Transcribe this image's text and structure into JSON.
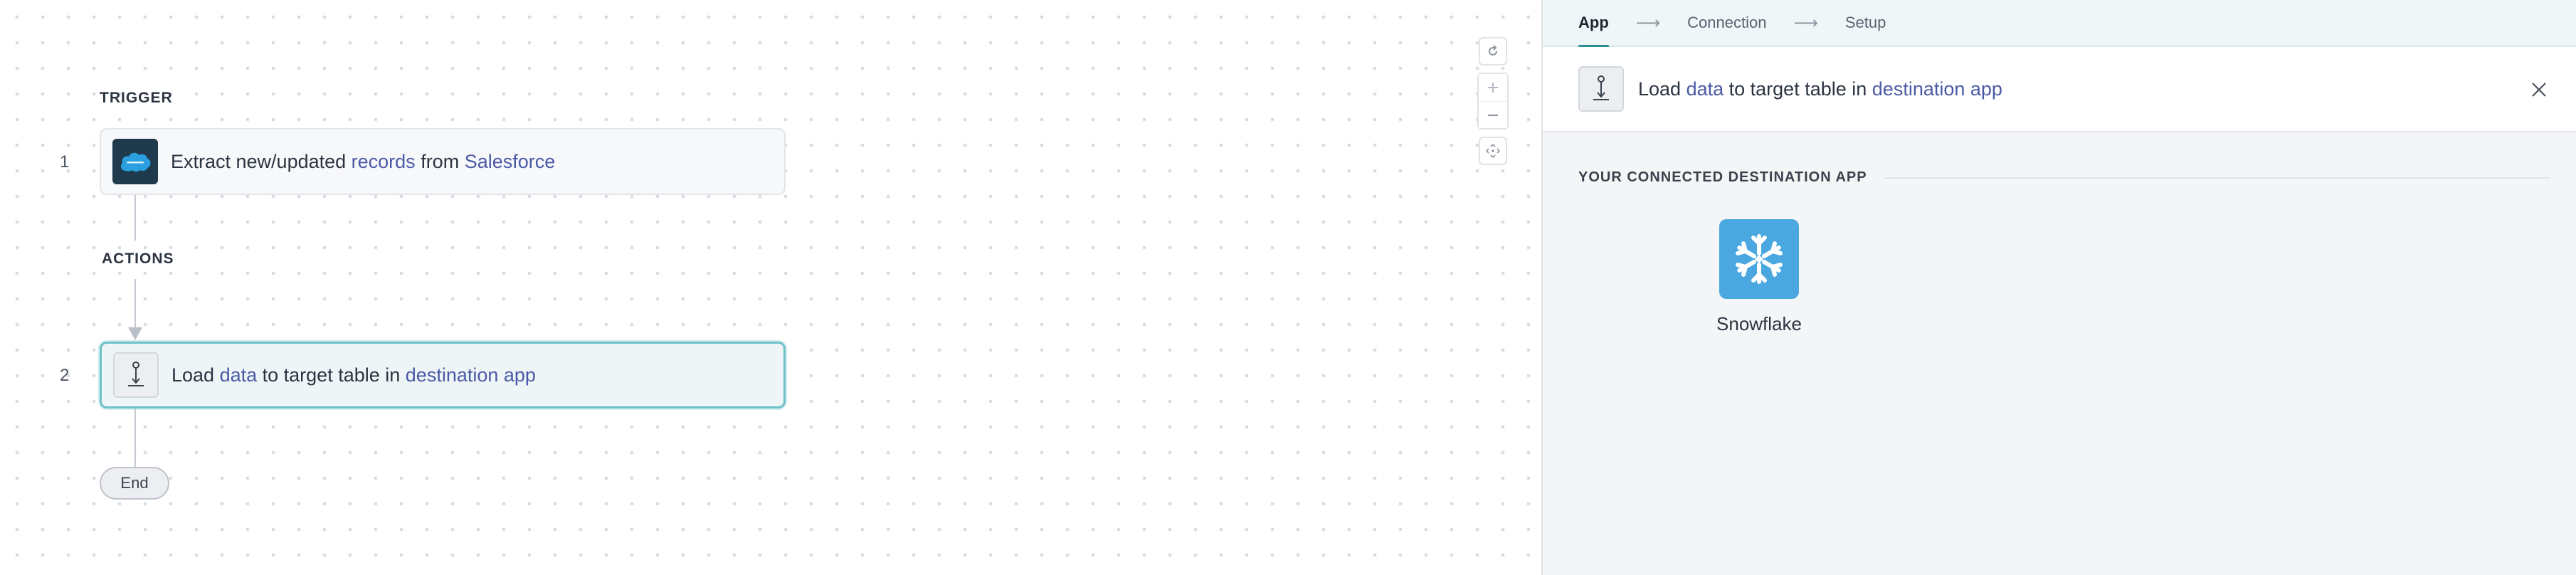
{
  "canvas": {
    "sections": {
      "trigger": "TRIGGER",
      "actions": "ACTIONS"
    },
    "steps": [
      {
        "number": "1",
        "icon": "salesforce-cloud-icon",
        "parts": [
          "Extract new/updated ",
          "records",
          " from ",
          "Salesforce"
        ]
      },
      {
        "number": "2",
        "icon": "load-data-icon",
        "parts": [
          "Load ",
          "data",
          " to target table in ",
          "destination app"
        ]
      }
    ],
    "end_label": "End",
    "controls": [
      "refresh-icon",
      "zoom-in-icon",
      "zoom-out-icon",
      "fit-view-icon"
    ]
  },
  "panel": {
    "tabs": [
      "App",
      "Connection",
      "Setup"
    ],
    "active_tab": "App",
    "header": {
      "parts": [
        "Load ",
        "data",
        " to target table in ",
        "destination app"
      ]
    },
    "section_label": "YOUR CONNECTED DESTINATION APP",
    "apps": [
      {
        "name": "Snowflake",
        "icon": "snowflake-icon"
      }
    ]
  },
  "colors": {
    "accent": "#2e8f97",
    "link": "#4b5aa6",
    "selected_border": "#6fc1c7",
    "snowflake": "#4aa7e0",
    "salesforce_tile": "#1e3a4c"
  }
}
